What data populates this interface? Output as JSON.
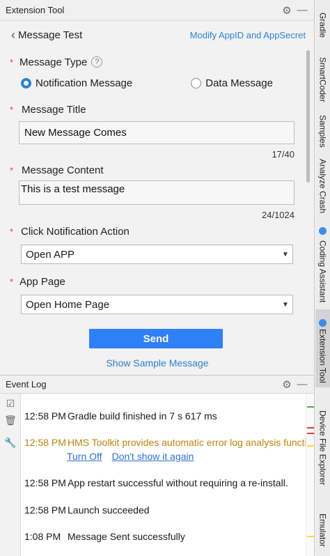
{
  "tool_window": {
    "title": "Extension Tool",
    "nav": {
      "title": "Message Test",
      "link": "Modify AppID and AppSecret"
    },
    "form": {
      "message_type_label": "Message Type",
      "message_type_options": [
        "Notification Message",
        "Data Message"
      ],
      "message_type_selected": "Notification Message",
      "message_title_label": "Message Title",
      "message_title_value": "New Message Comes",
      "message_title_counter": "17/40",
      "message_content_label": "Message Content",
      "message_content_value": "This is a test message",
      "message_content_counter": "24/1024",
      "click_action_label": "Click Notification Action",
      "click_action_value": "Open APP",
      "app_page_label": "App Page",
      "app_page_value": "Open Home Page"
    },
    "send_label": "Send",
    "sample_link": "Show Sample Message"
  },
  "event_log": {
    "title": "Event Log",
    "entries": [
      {
        "time": "12:58 PM",
        "text": "Gradle build finished in 7 s 617 ms",
        "level": "info"
      },
      {
        "time": "12:58 PM",
        "text": "HMS Toolkit provides automatic error log analysis function",
        "level": "warn",
        "links": [
          "Turn Off",
          "Don't show it again"
        ]
      },
      {
        "time": "12:58 PM",
        "text": "App restart successful without requiring a re-install.",
        "level": "info"
      },
      {
        "time": "12:58 PM",
        "text": "Launch succeeded",
        "level": "info"
      },
      {
        "time": "1:08 PM",
        "text": "Message Sent successfully",
        "level": "info"
      }
    ]
  },
  "right_stripe": [
    "Gradle",
    "SmartCoder",
    "Samples",
    "Analyze Crash",
    "Coding Assistant",
    "Extension Tool",
    "Device File Explorer",
    "Emulator"
  ],
  "colors": {
    "accent": "#2f7ff7",
    "link": "#2f80d1",
    "required": "#e0403a",
    "warning": "#b8860b"
  }
}
